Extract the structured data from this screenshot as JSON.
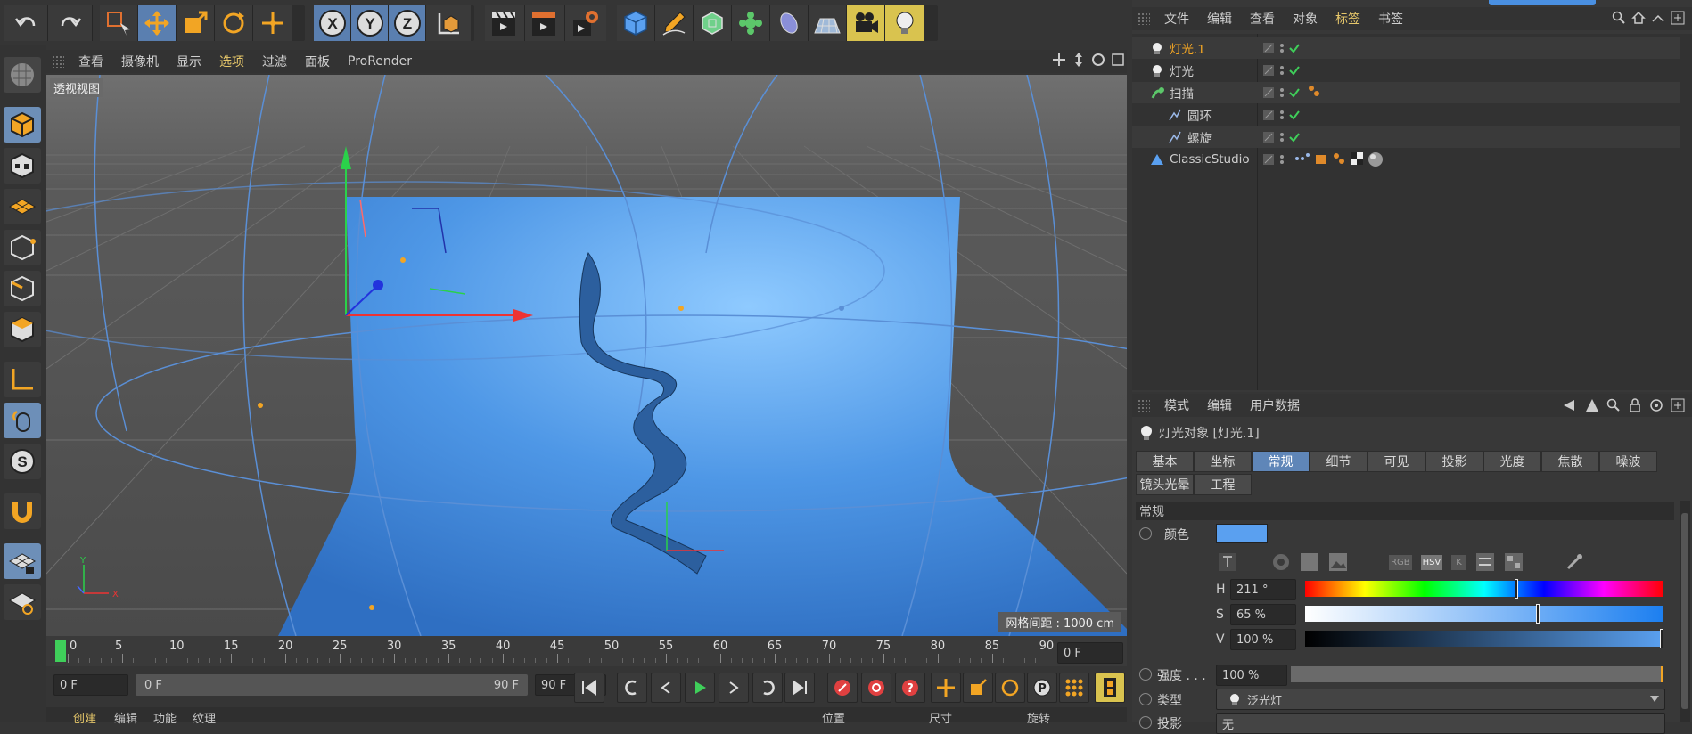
{
  "toolbar": {
    "undo": "undo-icon",
    "redo": "redo-icon",
    "axis_x": "X",
    "axis_y": "Y",
    "axis_z": "Z"
  },
  "viewport": {
    "menu": [
      "查看",
      "摄像机",
      "显示",
      "选项",
      "过滤",
      "面板",
      "ProRender"
    ],
    "active_menu": "选项",
    "label": "透视视图",
    "grid_info": "网格间距 : 1000 cm",
    "axis_y": "Y",
    "axis_x": "X"
  },
  "timeline": {
    "ticks": [
      "0",
      "5",
      "10",
      "15",
      "20",
      "25",
      "30",
      "35",
      "40",
      "45",
      "50",
      "55",
      "60",
      "65",
      "70",
      "75",
      "80",
      "85",
      "90"
    ],
    "current_frame": "0 F",
    "start_field": "0 F",
    "range_start": "0 F",
    "range_end": "90 F",
    "end_field": "90 F"
  },
  "bottom_tabs": [
    "创建",
    "编辑",
    "功能",
    "纹理"
  ],
  "bottom_right_labels": [
    "位置",
    "尺寸",
    "旋转"
  ],
  "object_manager": {
    "menu": [
      "文件",
      "编辑",
      "查看",
      "对象",
      "标签",
      "书签"
    ],
    "active_menu": "标签",
    "rows": [
      {
        "name": "灯光.1",
        "icon": "light-icon",
        "active": true
      },
      {
        "name": "灯光",
        "icon": "light-icon",
        "active": false
      },
      {
        "name": "扫描",
        "icon": "sweep-icon",
        "active": false
      },
      {
        "name": "圆环",
        "icon": "spline-icon",
        "active": false
      },
      {
        "name": "螺旋",
        "icon": "spline-icon",
        "active": false
      },
      {
        "name": "ClassicStudio",
        "icon": "studio-icon",
        "active": false
      }
    ]
  },
  "attributes": {
    "menu": [
      "模式",
      "编辑",
      "用户数据"
    ],
    "title": "灯光对象 [灯光.1]",
    "tabs_row1": [
      "基本",
      "坐标",
      "常规",
      "细节",
      "可见",
      "投影",
      "光度",
      "焦散",
      "噪波"
    ],
    "tabs_row2": [
      "镜头光晕",
      "工程"
    ],
    "active_tab": "常规",
    "section": "常规",
    "color_label": "颜色",
    "color_value": "#5aa0f0",
    "modes": [
      "RGB",
      "HSV",
      "K"
    ],
    "h_label": "H",
    "h_value": "211 °",
    "h_fraction": 0.59,
    "s_label": "S",
    "s_value": "65 %",
    "s_fraction": 0.65,
    "v_label": "V",
    "v_value": "100 %",
    "v_fraction": 1.0,
    "intensity_label": "强度 . . .",
    "intensity_value": "100 %",
    "type_label": "类型",
    "type_value": "泛光灯",
    "shadow_label": "投影",
    "shadow_value": "无"
  }
}
